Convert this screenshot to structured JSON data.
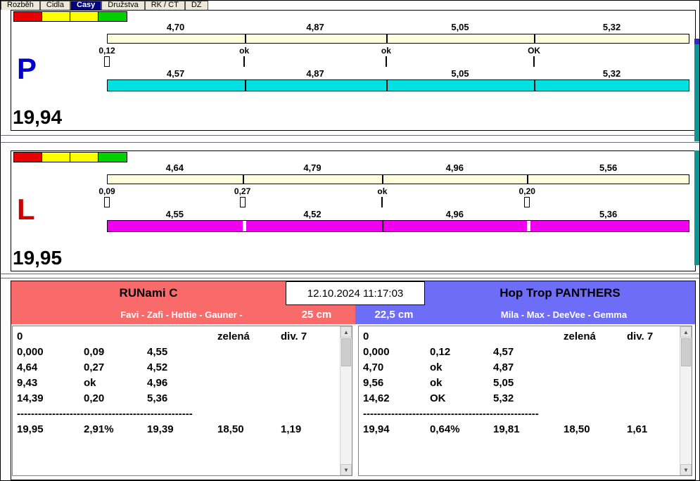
{
  "tabs": {
    "items": [
      {
        "label": "Rozběh",
        "selected": false
      },
      {
        "label": "Čidla",
        "selected": false
      },
      {
        "label": "Časy",
        "selected": true
      },
      {
        "label": "Družstva",
        "selected": false
      },
      {
        "label": "RK / ČT",
        "selected": false
      },
      {
        "label": "DZ",
        "selected": false
      }
    ]
  },
  "colors": {
    "left_team_header": "#f96b6b",
    "right_team_header": "#6d6df8",
    "p_lane_bar": "#00e2e2",
    "l_lane_bar": "#ee00ee",
    "expected_bar": "#ffffdc",
    "light_red": "#e80000",
    "light_yellow": "#ffff00",
    "light_green": "#00cf00",
    "p_letter": "#0000cc",
    "l_letter": "#cc0000",
    "selected_tab": "#000080"
  },
  "panels": [
    {
      "letter": "P",
      "total": "19,94",
      "top_values": [
        "4,70",
        "4,87",
        "5,05",
        "5,32"
      ],
      "changes": [
        {
          "label": "0,12",
          "marker": "box"
        },
        {
          "label": "ok",
          "marker": "line"
        },
        {
          "label": "ok",
          "marker": "line"
        },
        {
          "label": "OK",
          "marker": "line"
        }
      ],
      "bottom_values": [
        "4,57",
        "4,87",
        "5,05",
        "5,32"
      ]
    },
    {
      "letter": "L",
      "total": "19,95",
      "top_values": [
        "4,64",
        "4,79",
        "4,96",
        "5,56"
      ],
      "changes": [
        {
          "label": "0,09",
          "marker": "box"
        },
        {
          "label": "0,27",
          "marker": "box"
        },
        {
          "label": "ok",
          "marker": "line"
        },
        {
          "label": "0,20",
          "marker": "box"
        }
      ],
      "bottom_values": [
        "4,55",
        "4,52",
        "4,96",
        "5,36"
      ]
    }
  ],
  "scoreboard": {
    "datetime": "12.10.2024 11:17:03",
    "left": {
      "team": "RUNami C",
      "dogs": "Favi - Zafi - Hettie - Gauner -",
      "height": "25 cm",
      "header": {
        "c1": "0",
        "c4": "zelená",
        "c5": "div. 7"
      },
      "lines": [
        [
          "0,000",
          "0,09",
          "4,55"
        ],
        [
          "4,64",
          "0,27",
          "4,52"
        ],
        [
          "9,43",
          "ok",
          "4,96"
        ],
        [
          "14,39",
          "0,20",
          "5,36"
        ]
      ],
      "dashes": "--------------------------------------------------",
      "totals": [
        "19,95",
        "2,91%",
        "19,39",
        "18,50",
        "1,19"
      ]
    },
    "right": {
      "team": "Hop Trop PANTHERS",
      "dogs": "Mila - Max - DeeVee - Gemma",
      "height": "22,5 cm",
      "header": {
        "c1": "0",
        "c4": "zelená",
        "c5": "div. 7"
      },
      "lines": [
        [
          "0,000",
          "0,12",
          "4,57"
        ],
        [
          "4,70",
          "ok",
          "4,87"
        ],
        [
          "9,56",
          "ok",
          "5,05"
        ],
        [
          "14,62",
          "OK",
          "5,32"
        ]
      ],
      "dashes": "--------------------------------------------------",
      "totals": [
        "19,94",
        "0,64%",
        "19,81",
        "18,50",
        "1,61"
      ]
    }
  }
}
